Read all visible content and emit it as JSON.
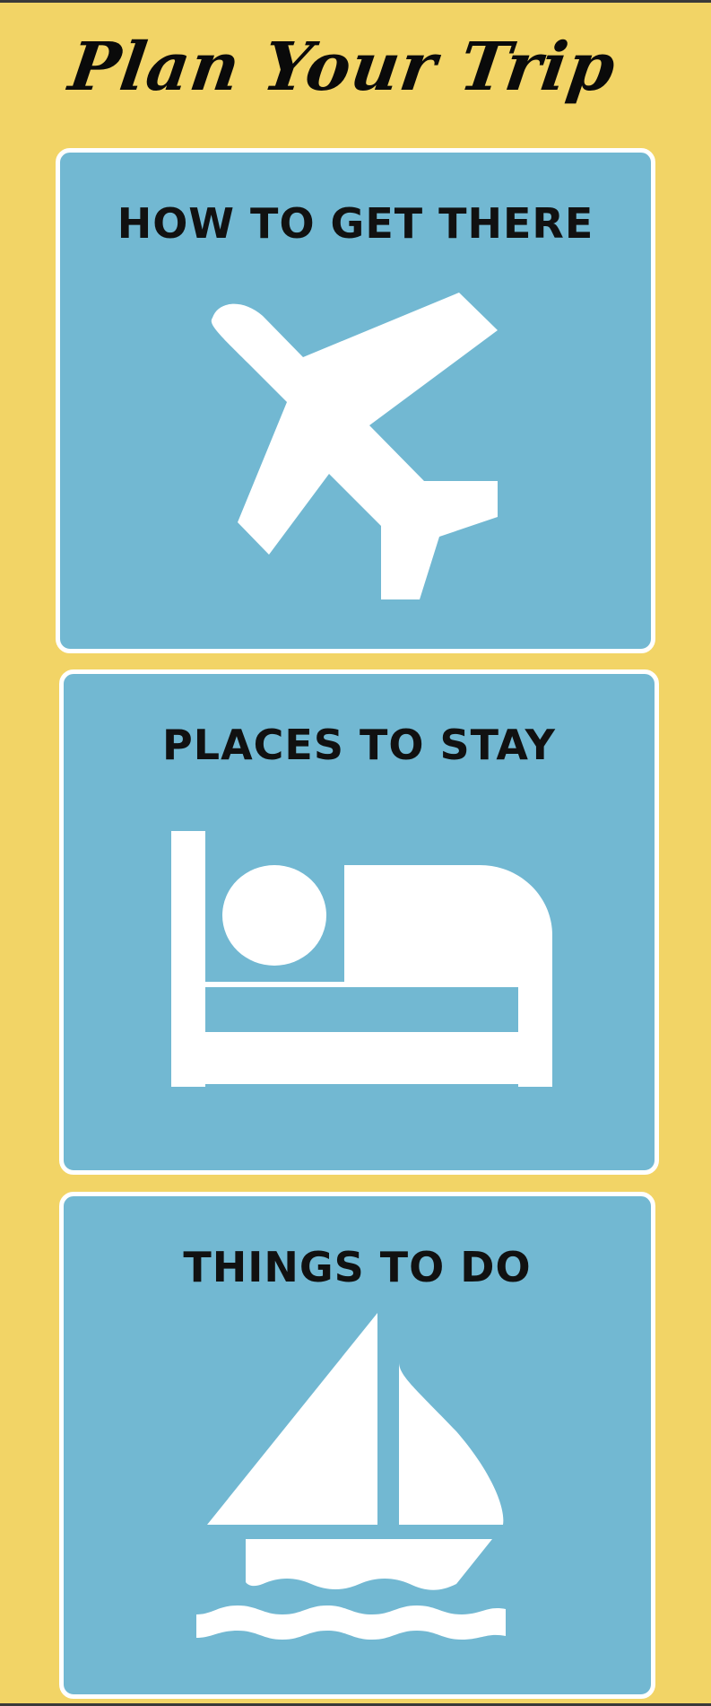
{
  "header": {
    "title": "Plan Your Trip"
  },
  "cards": [
    {
      "label": "HOW TO GET THERE",
      "icon": "airplane-icon"
    },
    {
      "label": "PLACES TO STAY",
      "icon": "bed-icon"
    },
    {
      "label": "THINGS TO DO",
      "icon": "sailboat-icon"
    }
  ],
  "colors": {
    "background": "#f2d466",
    "card": "#72b8d2",
    "card_border": "#ffffff",
    "text": "#111111"
  }
}
